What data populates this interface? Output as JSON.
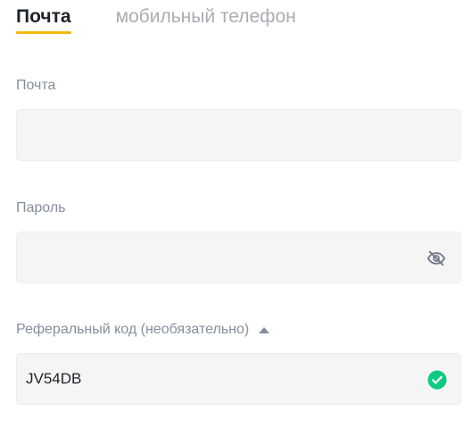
{
  "tabs": [
    {
      "label": "Почта",
      "active": true
    },
    {
      "label": "мобильный телефон",
      "active": false
    }
  ],
  "email": {
    "label": "Почта",
    "value": ""
  },
  "password": {
    "label": "Пароль",
    "value": "",
    "visibility_icon": "eye-off-icon"
  },
  "referral": {
    "label": "Реферальный код (необязательно)",
    "expanded": true,
    "toggle_icon": "caret-up-icon",
    "value": "JV54DB",
    "status_icon": "check-circle-icon",
    "status_color": "#0ecb81"
  },
  "colors": {
    "accent": "#f0b90b",
    "label": "#848e9c",
    "field_bg": "#f5f5f5"
  }
}
